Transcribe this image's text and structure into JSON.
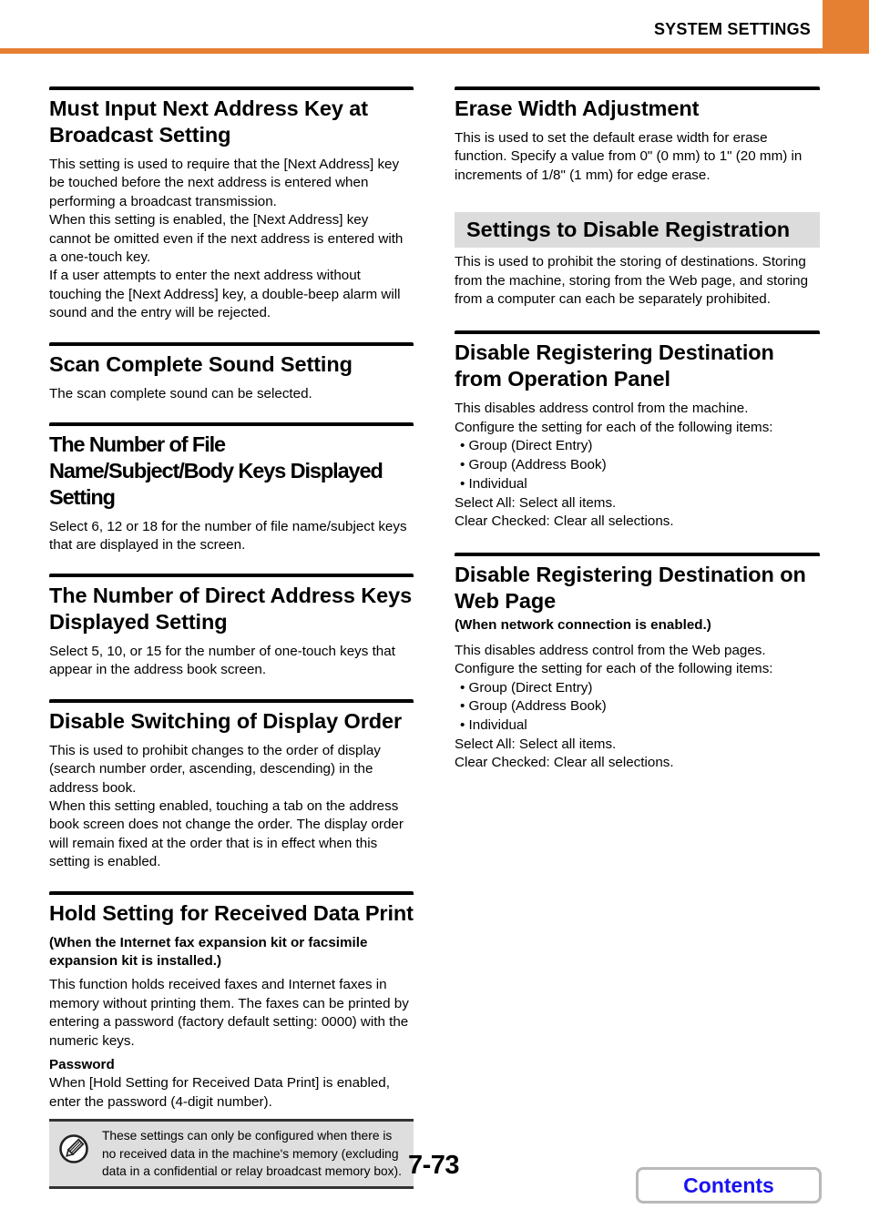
{
  "header": {
    "title": "SYSTEM SETTINGS",
    "accent_color": "#e58033"
  },
  "left": [
    {
      "heading": "Must Input Next Address Key at Broadcast Setting",
      "paragraphs": [
        "This setting is used to require that the [Next Address] key be touched before the next address is entered when performing a broadcast transmission.",
        "When this setting is enabled, the [Next Address] key cannot be omitted even if the next address is entered with a one-touch key.",
        "If a user attempts to enter the next address without touching the [Next Address] key, a double-beep alarm will sound and the entry will be rejected."
      ]
    },
    {
      "heading": "Scan Complete Sound Setting",
      "paragraphs": [
        "The scan complete sound can be selected."
      ]
    },
    {
      "heading": "The Number of File Name/Subject/Body Keys Displayed Setting",
      "paragraphs": [
        "Select 6, 12 or 18 for the number of file name/subject keys that are displayed in the screen."
      ]
    },
    {
      "heading": "The Number of Direct Address Keys Displayed Setting",
      "paragraphs": [
        "Select 5, 10, or 15 for the number of one-touch keys that appear in the address book screen."
      ]
    },
    {
      "heading": "Disable Switching of Display Order",
      "paragraphs": [
        "This is used to prohibit changes to the order of display (search number order, ascending, descending) in the address book.",
        "When this setting enabled, touching a tab on the address book screen does not change the order. The display order will remain fixed at the order that is in effect when this setting is enabled."
      ]
    },
    {
      "heading": "Hold Setting for Received Data Print",
      "condition": "(When the Internet fax expansion kit or facsimile expansion kit is installed.)",
      "paragraphs": [
        "This function holds received faxes and Internet faxes in memory without printing them. The faxes can be printed by entering a password (factory default setting: 0000) with the numeric keys."
      ],
      "subheading": "Password",
      "sub_paragraph": "When [Hold Setting for Received Data Print] is enabled, enter the password (4-digit number).",
      "note": {
        "icon": "pencil-note-icon",
        "text": "These settings can only be configured when there is no received data in the machine's memory (excluding data in a confidential or relay broadcast memory box)."
      }
    }
  ],
  "right": {
    "erase": {
      "heading": "Erase Width Adjustment",
      "paragraph": "This is used to set the default erase width for erase function. Specify a value from 0\" (0 mm) to 1\" (20 mm) in increments of 1/8\" (1 mm) for edge erase."
    },
    "disable_registration": {
      "heading": "Settings to Disable Registration",
      "paragraph": "This is used to prohibit the storing of destinations. Storing from the machine, storing from the Web page, and storing from a computer can each be separately prohibited."
    },
    "operation_panel": {
      "heading": "Disable Registering Destination from Operation Panel",
      "lines": [
        "This disables address control from the machine.",
        "Configure the setting for each of the following items:"
      ],
      "items": [
        "Group (Direct Entry)",
        "Group (Address Book)",
        "Individual"
      ],
      "after": [
        "Select All: Select all items.",
        "Clear Checked: Clear all selections."
      ]
    },
    "web_page": {
      "heading": "Disable Registering Destination on Web Page",
      "condition": "(When network connection is enabled.)",
      "lines": [
        "This disables address control from the Web pages.",
        "Configure the setting for each of the following items:"
      ],
      "items": [
        "Group (Direct Entry)",
        "Group (Address Book)",
        "Individual"
      ],
      "after": [
        "Select All: Select all items.",
        "Clear Checked: Clear all selections."
      ]
    }
  },
  "footer": {
    "page_number": "7-73",
    "contents_label": "Contents",
    "contents_color": "#1a12f0"
  }
}
